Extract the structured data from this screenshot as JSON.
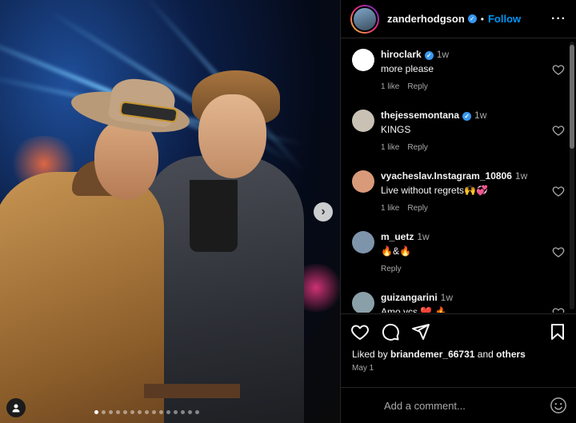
{
  "post": {
    "author": "zanderhodgson",
    "follow_label": "Follow",
    "separator": "•"
  },
  "comments": [
    {
      "user": "hiroclark",
      "verified": true,
      "time": "1w",
      "text": "more please",
      "likes": "1 like",
      "reply": "Reply",
      "avatar_color": "#ffffff"
    },
    {
      "user": "thejessemontana",
      "verified": true,
      "time": "1w",
      "text": "KINGS",
      "likes": "1 like",
      "reply": "Reply",
      "avatar_color": "#c9c2b4"
    },
    {
      "user": "vyacheslav.Instagram_10806",
      "verified": false,
      "time": "1w",
      "text": "Live without regrets🙌💞",
      "likes": "1 like",
      "reply": "Reply",
      "avatar_color": "#d99a7a"
    },
    {
      "user": "m_uetz",
      "verified": false,
      "time": "1w",
      "text": "🔥&🔥",
      "likes": "",
      "reply": "Reply",
      "avatar_color": "#7e94ab"
    },
    {
      "user": "guizangarini",
      "verified": false,
      "time": "1w",
      "text": "Amo vcs ❤️ 🔥",
      "likes": "",
      "reply": "",
      "avatar_color": "#8aa0a8"
    }
  ],
  "engagement": {
    "liked_by_prefix": "Liked by",
    "liked_by_user": "briandemer_66731",
    "and_word": "and",
    "others": "others",
    "date": "May 1"
  },
  "composer": {
    "placeholder": "Add a comment..."
  },
  "icons": {
    "like": "heart-icon",
    "comment": "comment-icon",
    "share": "share-icon",
    "save": "bookmark-icon",
    "emoji": "emoji-icon",
    "more": "more-icon",
    "next": "chevron-right-icon",
    "tag": "user-tag-icon"
  },
  "carousel": {
    "count": 15,
    "active": 0
  },
  "colors": {
    "accent": "#0095f6",
    "verified": "#3897f0",
    "panel_bg": "#000000",
    "heart": "#ed4956"
  }
}
